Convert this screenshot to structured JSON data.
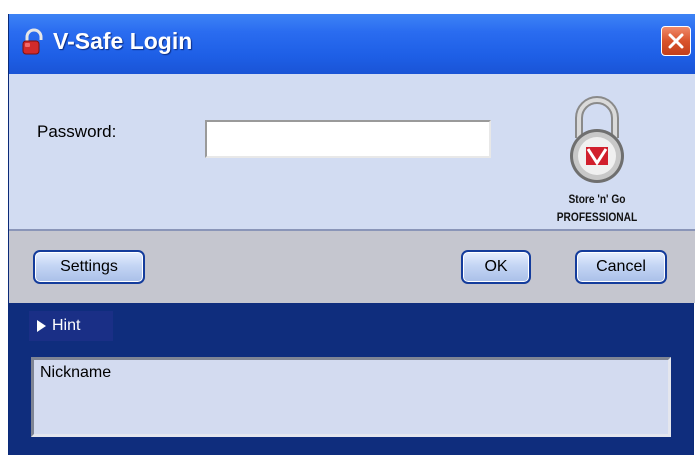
{
  "window": {
    "title": "V-Safe Login",
    "close_icon": "close-x-icon"
  },
  "form": {
    "password_label": "Password:",
    "password_value": "",
    "password_placeholder": ""
  },
  "branding": {
    "icon": "padlock-icon",
    "line1": "Store 'n' Go",
    "line2": "PROFESSIONAL"
  },
  "buttons": {
    "settings": "Settings",
    "ok": "OK",
    "cancel": "Cancel"
  },
  "hint": {
    "toggle_label": "Hint",
    "toggle_icon": "triangle-right-icon",
    "text": "Nickname"
  },
  "colors": {
    "titlebar": "#2a6cf0",
    "panel": "#d2dcf2",
    "button_bar": "#c5c6cf",
    "frame": "#0f2d7d",
    "close_button": "#d9532c"
  }
}
